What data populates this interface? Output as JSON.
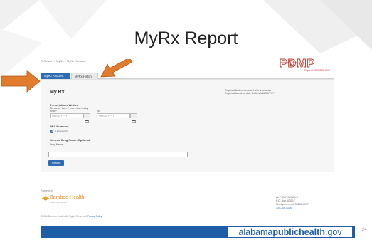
{
  "slide": {
    "title": "MyRx Report",
    "page_number": "24"
  },
  "app": {
    "breadcrumb": "RxSearch  >  MyRx  >  MyRx Request",
    "logo_text": "PDMP",
    "support_text": "Support: 855-825-4767",
    "tabs": [
      {
        "label": "MyRx Request",
        "active": true
      },
      {
        "label": "MyRx History",
        "active": false
      }
    ],
    "panel": {
      "heading": "My Rx",
      "required_note_1": "Required fields are marked with an asterisk *",
      "required_note_2": "Required format for date fields is MM/DD/YYYY",
      "prescriptions_label": "Prescriptions Written",
      "prescriptions_hint": "No earlier than 2 years from today",
      "from_label": "From*",
      "to_label": "To*",
      "from_placeholder": "MM/DD/YYYY",
      "to_placeholder": "MM/DD/YYYY",
      "dea_label": "DEA Numbers",
      "dea_value": "AA0000000",
      "dea_checked": true,
      "generic_label": "Generic Drug Name (Optional)",
      "drug_name_label": "Drug Name",
      "drug_name_value": "",
      "search_label": "Search"
    },
    "footer": {
      "powered_by": "Powered by",
      "bamboo_name": "Bamboo Health",
      "bamboo_sub": "PMP AWARxE®",
      "copyright": "©2024 Bamboo Health. All Rights Reserved. ",
      "privacy": "Privacy Policy",
      "addr_1": "AL PDMP AWARxE",
      "addr_2": "P.O. Box 303017",
      "addr_3": "Montgomery, AL 36130-3017",
      "phone": "334-206-5226"
    }
  },
  "bottom_banner": {
    "text_regular_1": "alabama",
    "text_bold": "publichealth",
    "text_regular_2": ".gov"
  },
  "colors": {
    "accent_blue": "#2e6db4",
    "banner_blue": "#1f5da9",
    "arrow_orange": "#e07c2c",
    "pdmp_red": "#c0392b"
  }
}
